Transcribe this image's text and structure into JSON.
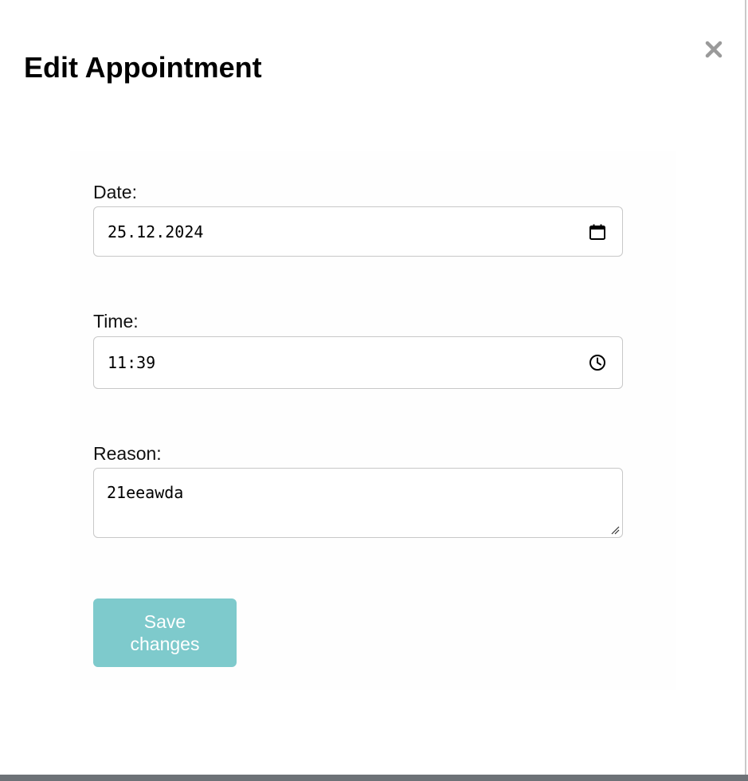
{
  "modal": {
    "title": "Edit Appointment",
    "close_icon": "close-icon"
  },
  "form": {
    "date": {
      "label": "Date:",
      "value": "25.12.2024",
      "icon": "calendar-icon"
    },
    "time": {
      "label": "Time:",
      "value": "11:39",
      "icon": "clock-icon"
    },
    "reason": {
      "label": "Reason:",
      "value": "21eeawda"
    },
    "save_label": "Save changes"
  },
  "colors": {
    "save_button": "#7ecacc",
    "close_icon": "#9a9a9a",
    "input_border": "#c8c8c8"
  }
}
